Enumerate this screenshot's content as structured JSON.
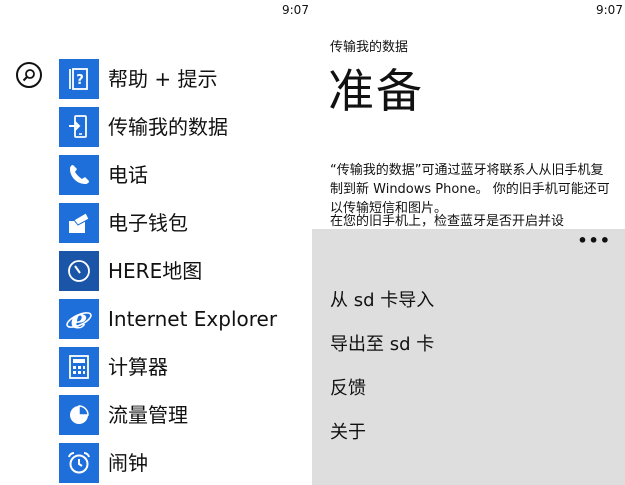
{
  "status_bar": {
    "time_left": "9:07",
    "time_right": "9:07"
  },
  "colors": {
    "tile": "#1e6fd9",
    "tile_dark": "#1a55a8",
    "overlay": "#dedede"
  },
  "app_list": {
    "search_icon": "search-icon",
    "items": [
      {
        "label": "帮助 + 提示",
        "icon": "help-icon"
      },
      {
        "label": "传输我的数据",
        "icon": "transfer-icon"
      },
      {
        "label": "电话",
        "icon": "phone-icon"
      },
      {
        "label": "电子钱包",
        "icon": "wallet-icon"
      },
      {
        "label": "HERE地图",
        "icon": "compass-icon"
      },
      {
        "label": "Internet Explorer",
        "icon": "ie-icon"
      },
      {
        "label": "计算器",
        "icon": "calculator-icon"
      },
      {
        "label": "流量管理",
        "icon": "pie-chart-icon"
      },
      {
        "label": "闹钟",
        "icon": "alarm-icon"
      }
    ]
  },
  "detail": {
    "app_title": "传输我的数据",
    "page_title": "准备",
    "paragraph1": "“传输我的数据”可通过蓝牙将联系人从旧手机复制到新 Windows Phone。 你的旧手机可能还可以传输短信和图片。",
    "paragraph2": "在您的旧手机上，检查蓝牙是否开启并设",
    "more_label": "•••",
    "menu": [
      {
        "label": "从 sd 卡导入"
      },
      {
        "label": "导出至 sd 卡"
      },
      {
        "label": "反馈"
      },
      {
        "label": "关于"
      }
    ]
  }
}
